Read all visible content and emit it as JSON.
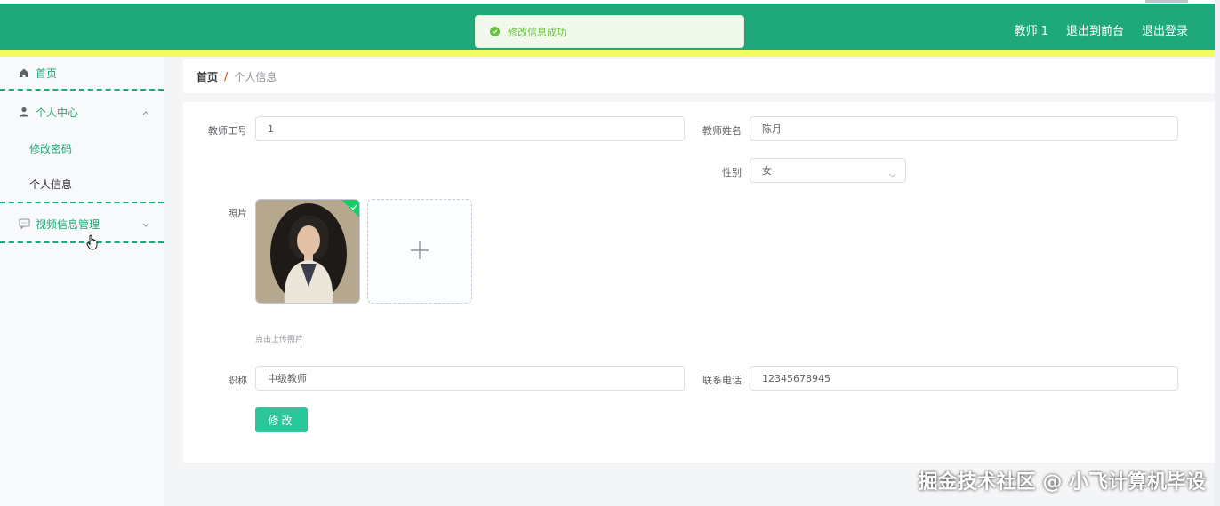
{
  "header": {
    "user_label": "教师 1",
    "exit_front_label": "退出到前台",
    "logout_label": "退出登录"
  },
  "toast": {
    "message": "修改信息成功"
  },
  "sidebar": {
    "items": [
      {
        "label": "首页",
        "icon": "home-icon"
      },
      {
        "label": "个人中心",
        "icon": "user-icon"
      },
      {
        "label": "修改密码"
      },
      {
        "label": "个人信息"
      },
      {
        "label": "视频信息管理",
        "icon": "message-icon"
      }
    ]
  },
  "breadcrumb": {
    "home": "首页",
    "separator": "/",
    "current": "个人信息"
  },
  "form": {
    "teacher_id": {
      "label": "教师工号",
      "value": "1"
    },
    "teacher_name": {
      "label": "教师姓名",
      "value": "陈月"
    },
    "gender": {
      "label": "性别",
      "value": "女"
    },
    "photo": {
      "label": "照片",
      "hint": "点击上传照片"
    },
    "title": {
      "label": "职称",
      "value": "中级教师"
    },
    "phone": {
      "label": "联系电话",
      "value": "12345678945"
    },
    "submit_label": "修改"
  },
  "watermark": "掘金技术社区 @ 小飞计算机毕设",
  "colors": {
    "primary": "#1fa97b",
    "accent_bar": "#f3fb62",
    "button": "#2bc79b",
    "success": "#67c23a",
    "breadcrumb_sep": "#e8572b"
  }
}
